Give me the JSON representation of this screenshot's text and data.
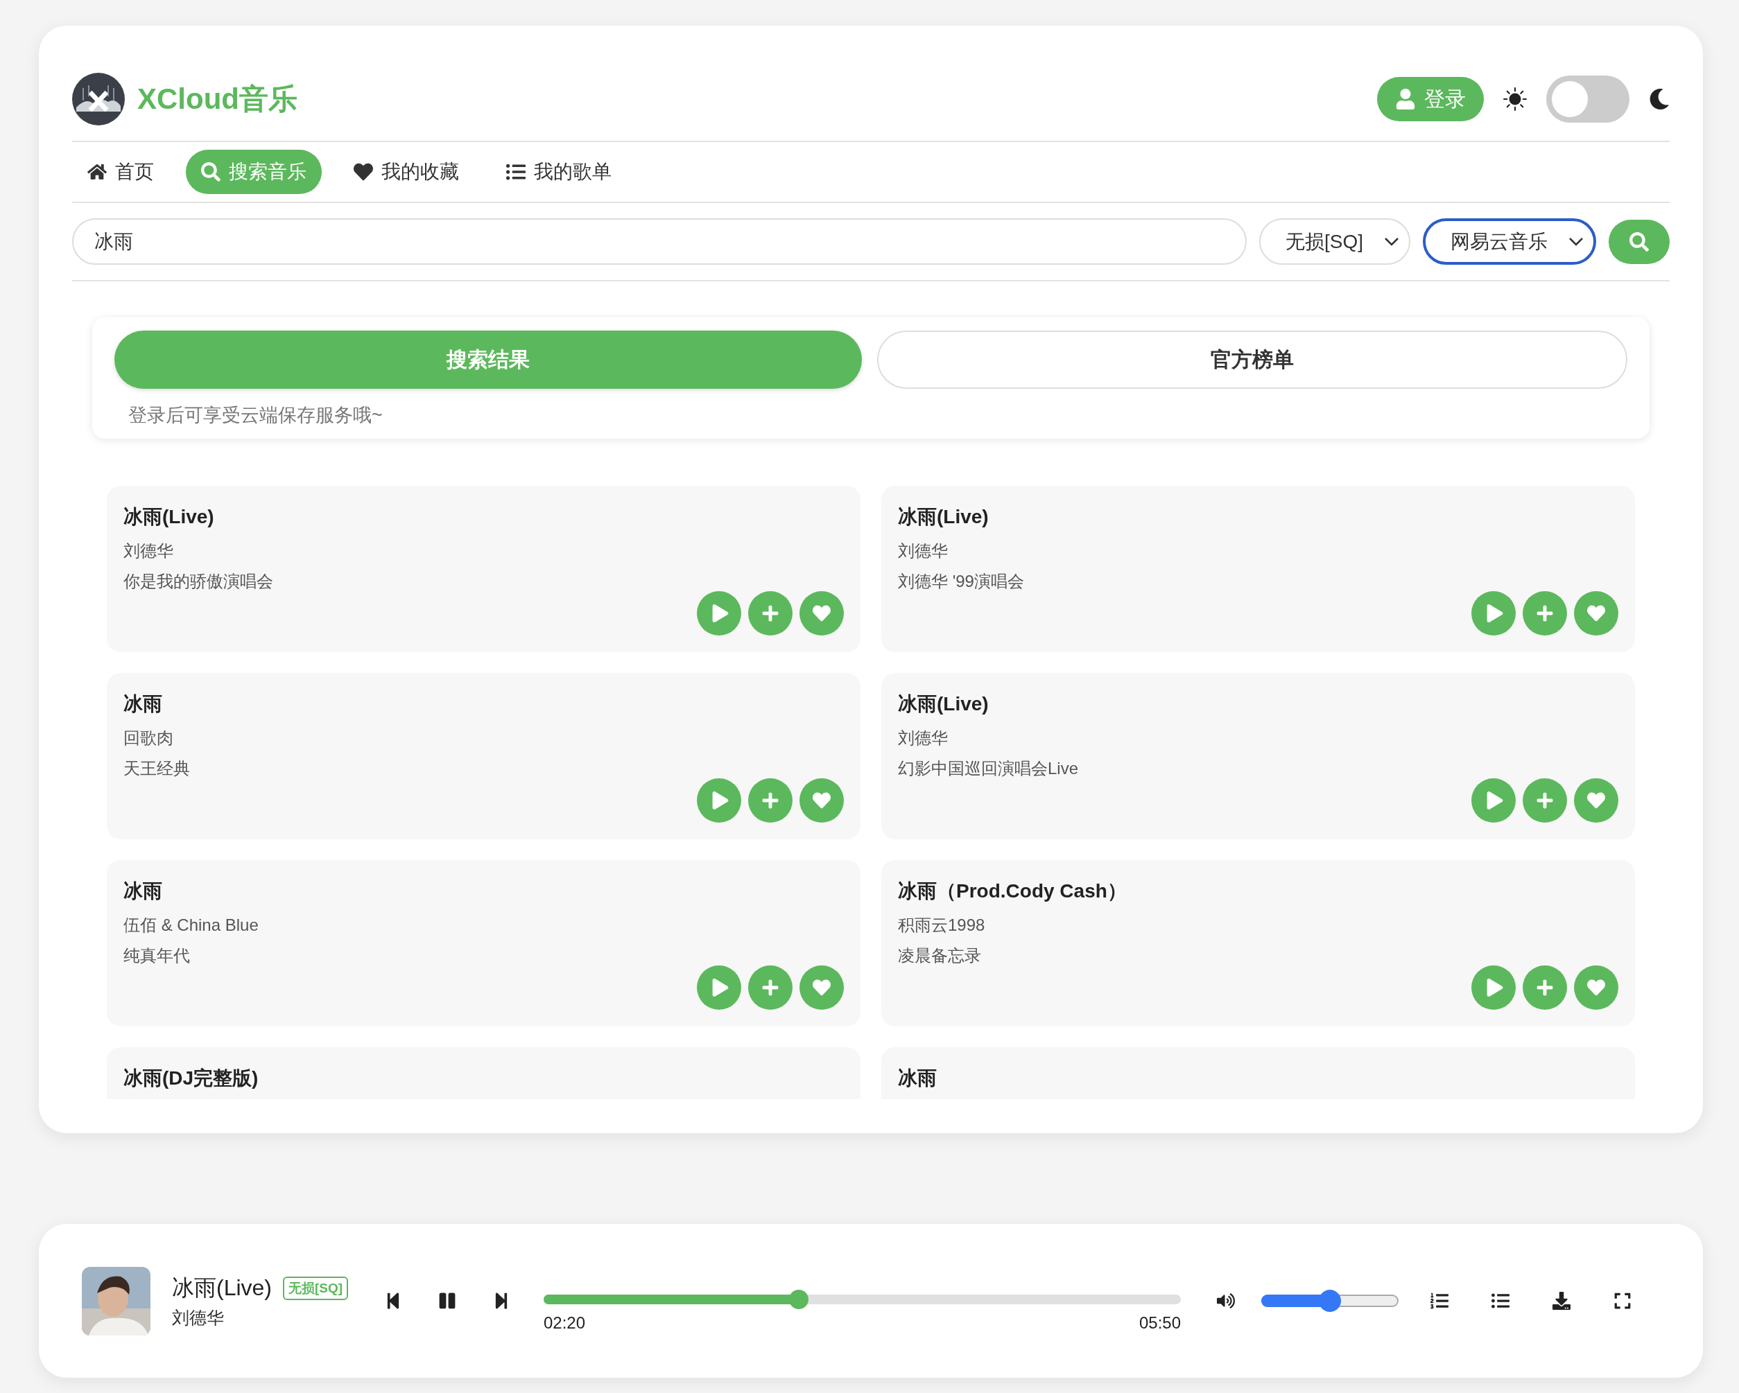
{
  "app": {
    "name": "XCloud音乐"
  },
  "header": {
    "login_label": "登录",
    "dark_mode": false
  },
  "nav": [
    {
      "label": "首页",
      "kind": "home",
      "selected": false
    },
    {
      "label": "搜索音乐",
      "kind": "search",
      "selected": true
    },
    {
      "label": "我的收藏",
      "kind": "favorites",
      "selected": false
    },
    {
      "label": "我的歌单",
      "kind": "playlists",
      "selected": false
    }
  ],
  "search": {
    "value": "冰雨",
    "quality": "无损[SQ]",
    "source": "网易云音乐"
  },
  "result_tabs": [
    {
      "label": "搜索结果",
      "selected": true
    },
    {
      "label": "官方榜单",
      "selected": false
    }
  ],
  "hint": "登录后可享受云端保存服务哦~",
  "songs": [
    {
      "title": "冰雨(Live)",
      "artist": "刘德华",
      "album": "你是我的骄傲演唱会"
    },
    {
      "title": "冰雨(Live)",
      "artist": "刘德华",
      "album": "刘德华 '99演唱会"
    },
    {
      "title": "冰雨",
      "artist": "回歌肉",
      "album": "天王经典"
    },
    {
      "title": "冰雨(Live)",
      "artist": "刘德华",
      "album": "幻影中国巡回演唱会Live"
    },
    {
      "title": "冰雨",
      "artist": "伍佰 & China Blue",
      "album": "纯真年代"
    },
    {
      "title": "冰雨（Prod.Cody Cash）",
      "artist": "积雨云1998",
      "album": "凌晨备忘录"
    },
    {
      "title": "冰雨(DJ完整版)"
    },
    {
      "title": "冰雨"
    }
  ],
  "player": {
    "title": "冰雨(Live)",
    "quality_badge": "无损[SQ]",
    "artist": "刘德华",
    "playing": true,
    "elapsed": "02:20",
    "duration": "05:50",
    "level": 0.4,
    "volume": {
      "level": 0.5
    }
  }
}
